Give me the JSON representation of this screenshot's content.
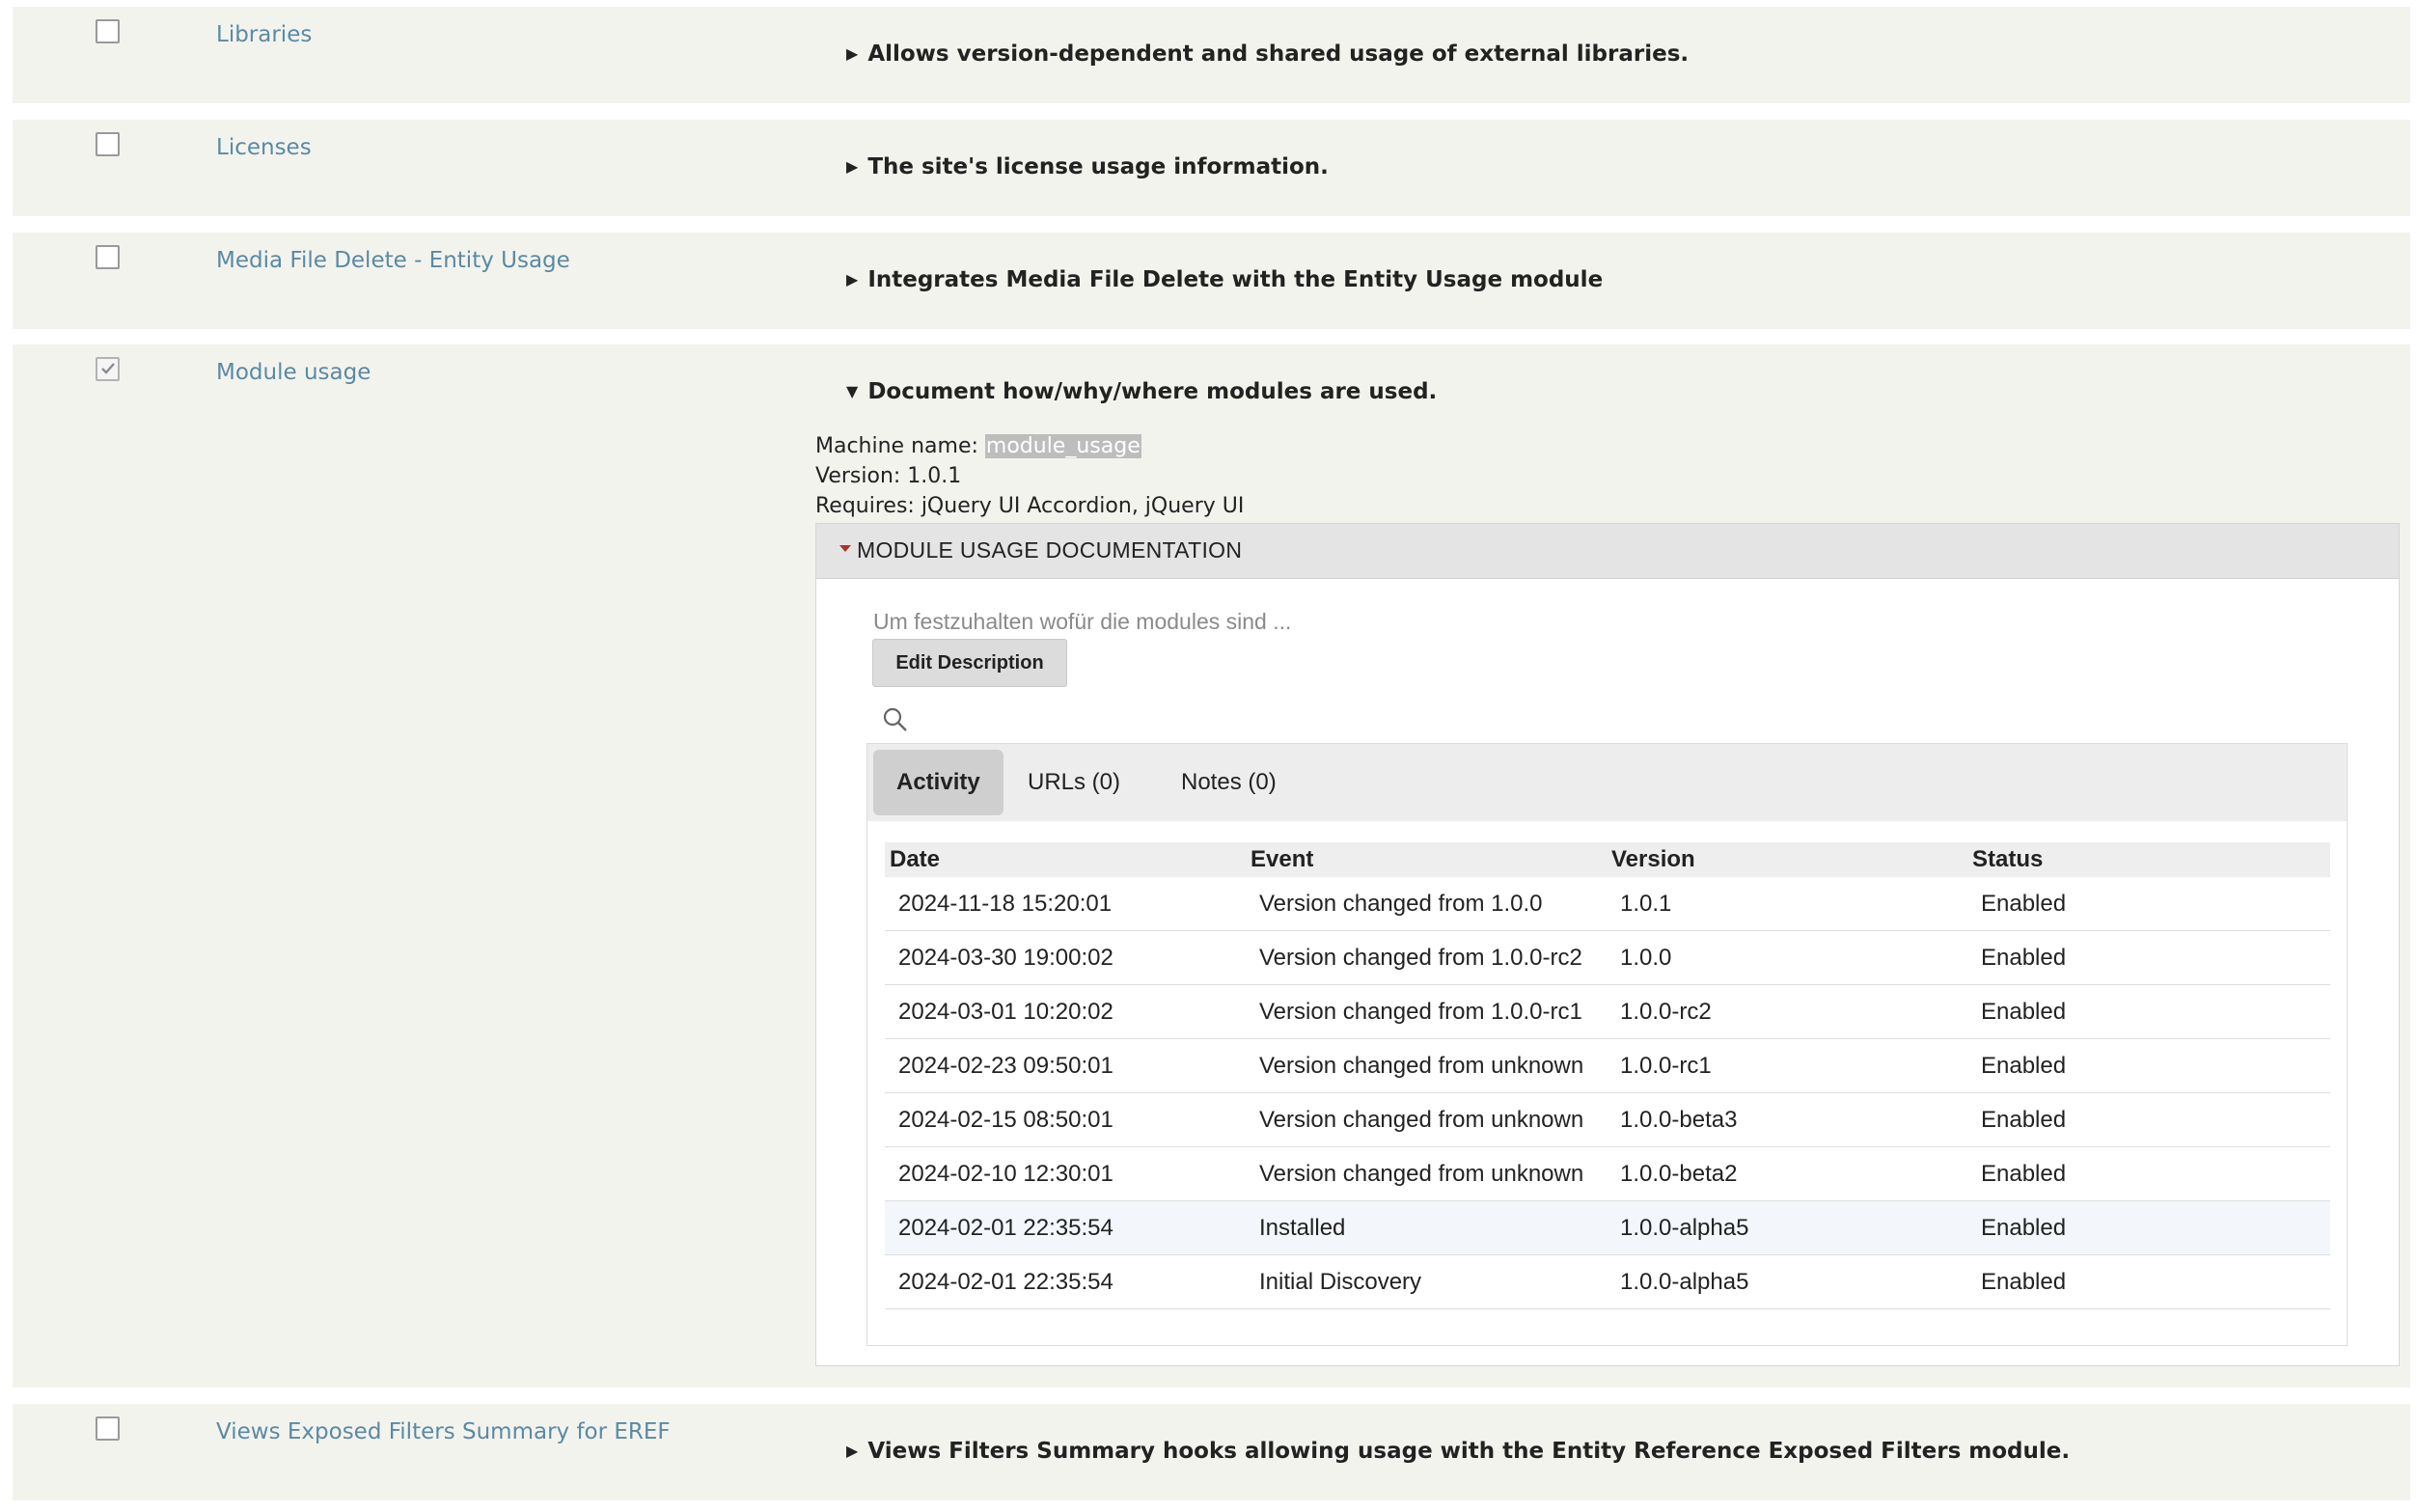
{
  "modules": [
    {
      "name": "Libraries",
      "summary": "Allows version-dependent and shared usage of external libraries.",
      "checked": false
    },
    {
      "name": "Licenses",
      "summary": "The site's license usage information.",
      "checked": false
    },
    {
      "name": "Media File Delete - Entity Usage",
      "summary": "Integrates Media File Delete with the Entity Usage module",
      "checked": false
    },
    {
      "name": "Module usage",
      "summary": "Document how/why/where modules are used.",
      "checked": true
    },
    {
      "name": "Views Exposed Filters Summary for EREF",
      "summary": "Views Filters Summary hooks allowing usage with the Entity Reference Exposed Filters module.",
      "checked": false
    }
  ],
  "expanded": {
    "machine_label": "Machine name:",
    "machine_value": "module_usage",
    "version_text": "Version: 1.0.1",
    "requires_text": "Requires: jQuery UI Accordion, jQuery UI",
    "accordion_title": "MODULE USAGE DOCUMENTATION",
    "description": "Um festzuhalten wofür die modules sind ...",
    "edit_button": "Edit Description",
    "tabs": [
      "Activity",
      "URLs (0)",
      "Notes (0)"
    ],
    "active_tab": "Activity",
    "columns": [
      "Date",
      "Event",
      "Version",
      "Status"
    ],
    "rows": [
      [
        "2024-11-18 15:20:01",
        "Version changed from 1.0.0",
        "1.0.1",
        "Enabled"
      ],
      [
        "2024-03-30 19:00:02",
        "Version changed from 1.0.0-rc2",
        "1.0.0",
        "Enabled"
      ],
      [
        "2024-03-01 10:20:02",
        "Version changed from 1.0.0-rc1",
        "1.0.0-rc2",
        "Enabled"
      ],
      [
        "2024-02-23 09:50:01",
        "Version changed from unknown",
        "1.0.0-rc1",
        "Enabled"
      ],
      [
        "2024-02-15 08:50:01",
        "Version changed from unknown",
        "1.0.0-beta3",
        "Enabled"
      ],
      [
        "2024-02-10 12:30:01",
        "Version changed from unknown",
        "1.0.0-beta2",
        "Enabled"
      ],
      [
        "2024-02-01 22:35:54",
        "Installed",
        "1.0.0-alpha5",
        "Enabled"
      ],
      [
        "2024-02-01 22:35:54",
        "Initial Discovery",
        "1.0.0-alpha5",
        "Enabled"
      ]
    ]
  },
  "colors": {
    "row_bg": "#f3f3ee",
    "link": "#5a8aa3",
    "accent_caret": "#b0302a"
  }
}
